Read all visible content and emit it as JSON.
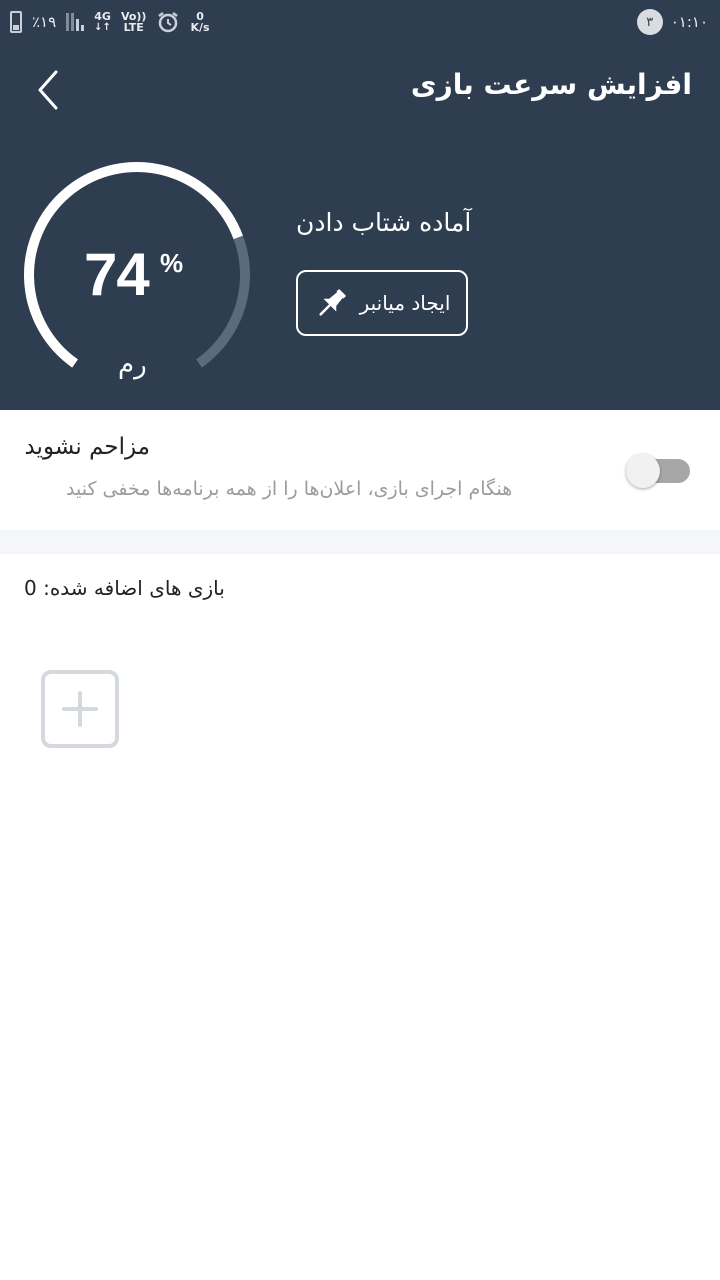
{
  "status_bar": {
    "battery_percent": "٪۱۹",
    "network": "4G",
    "volte_top": "Vo))",
    "volte_bottom": "LTE",
    "speed_value": "0",
    "speed_unit": "K/s",
    "notification_count": "۳",
    "time": "۰۱:۱۰"
  },
  "header": {
    "title": "افزایش سرعت بازی",
    "back_icon": "chevron-left-icon"
  },
  "gauge": {
    "value_text": "74",
    "percent_sign": "%",
    "label": "رم",
    "fill_fraction": 0.74
  },
  "boost": {
    "status": "آماده شتاب دادن",
    "shortcut_label": "ایجاد میانبر",
    "shortcut_icon": "pin-icon"
  },
  "do_not_disturb": {
    "title": "مزاحم نشوید",
    "description": "هنگام اجرای بازی، اعلان‌ها را از همه برنامه‌ها مخفی کنید",
    "enabled": false
  },
  "games": {
    "added_label": "بازی های اضافه شده: 0",
    "add_icon": "plus-icon"
  },
  "colors": {
    "header_bg": "#2e3d4f",
    "accent": "#ffffff",
    "muted_text": "#9b9b9b"
  }
}
